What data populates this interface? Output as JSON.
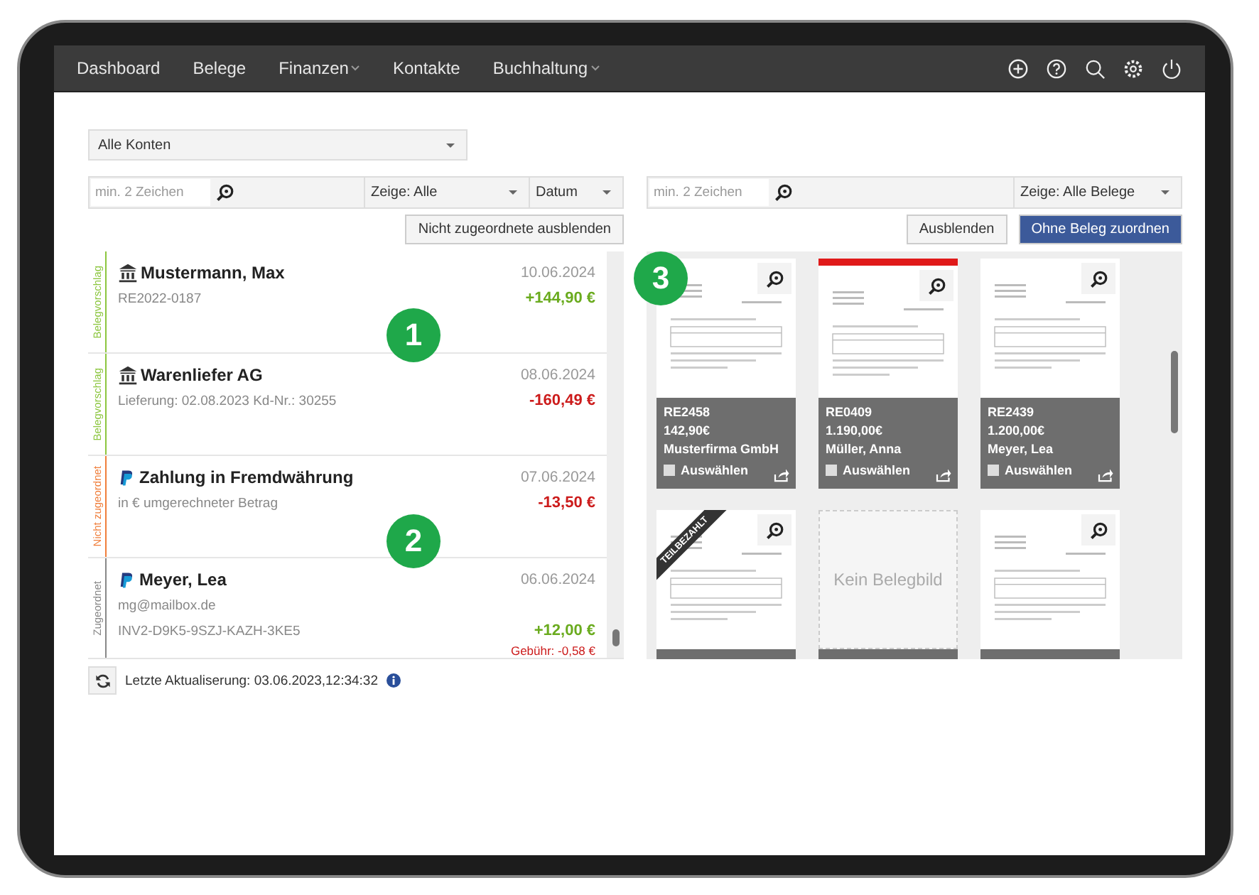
{
  "nav": {
    "items": [
      {
        "label": "Dashboard",
        "dropdown": false
      },
      {
        "label": "Belege",
        "dropdown": false
      },
      {
        "label": "Finanzen",
        "dropdown": true
      },
      {
        "label": "Kontakte",
        "dropdown": false
      },
      {
        "label": "Buchhaltung",
        "dropdown": true
      }
    ]
  },
  "account_select": {
    "value": "Alle Konten"
  },
  "transactions_panel": {
    "search": {
      "placeholder": "min. 2 Zeichen"
    },
    "filter": "Zeige: Alle",
    "sort": "Datum",
    "hide_button": "Nicht zugeordnete ausblenden",
    "transactions": [
      {
        "kind": "bank",
        "status": {
          "label": "Belegvorschlag",
          "color": "#8cc63f"
        },
        "name": "Mustermann, Max",
        "date": "10.06.2024",
        "details": [
          "RE2022-0187"
        ],
        "amount": {
          "text": "+144,90 €",
          "color": "#6aab1e"
        }
      },
      {
        "kind": "bank",
        "status": {
          "label": "Belegvorschlag",
          "color": "#8cc63f"
        },
        "name": "Warenliefer AG",
        "date": "08.06.2024",
        "details": [
          "Lieferung: 02.08.2023 Kd-Nr.: 30255"
        ],
        "amount": {
          "text": "-160,49 €",
          "color": "#cc1b1b"
        }
      },
      {
        "kind": "paypal",
        "status": {
          "label": "Nicht zugeordnet",
          "color": "#f07f3c"
        },
        "name": "Zahlung in Fremdwährung",
        "date": "07.06.2024",
        "details": [
          "in € umgerechneter Betrag"
        ],
        "amount": {
          "text": "-13,50 €",
          "color": "#cc1b1b"
        }
      },
      {
        "kind": "paypal",
        "status": {
          "label": "Zugeordnet",
          "color": "#888888"
        },
        "name": "Meyer, Lea",
        "date": "06.06.2024",
        "details": [
          "mg@mailbox.de",
          "INV2-D9K5-9SZJ-KAZH-3KE5"
        ],
        "amount": {
          "text": "+12,00 €",
          "color": "#6aab1e"
        },
        "fee": "Gebühr: -0,58 €"
      }
    ],
    "last_update": "Letzte Aktualiserung: 03.06.2023,12:34:32"
  },
  "receipts_panel": {
    "search": {
      "placeholder": "min. 2 Zeichen"
    },
    "filter": "Zeige: Alle Belege",
    "hide_button": "Ausblenden",
    "assign_button": "Ohne Beleg zuordnen",
    "receipts": [
      {
        "kind": "image",
        "flagged": false,
        "number": "RE2458",
        "amount": "142,90€",
        "contact": "Musterfirma GmbH",
        "select_label": "Auswählen",
        "checked": false
      },
      {
        "kind": "image",
        "flagged": true,
        "number": "RE0409",
        "amount": "1.190,00€",
        "contact": "Müller, Anna",
        "select_label": "Auswählen",
        "checked": false
      },
      {
        "kind": "image",
        "flagged": false,
        "number": "RE2439",
        "amount": "1.200,00€",
        "contact": "Meyer, Lea",
        "select_label": "Auswählen",
        "checked": false
      },
      {
        "kind": "image",
        "ribbon": "TEILBEZAHLT"
      },
      {
        "kind": "empty",
        "placeholder_text": "Kein Belegbild"
      },
      {
        "kind": "image"
      }
    ]
  },
  "markers": [
    "1",
    "2",
    "3"
  ]
}
